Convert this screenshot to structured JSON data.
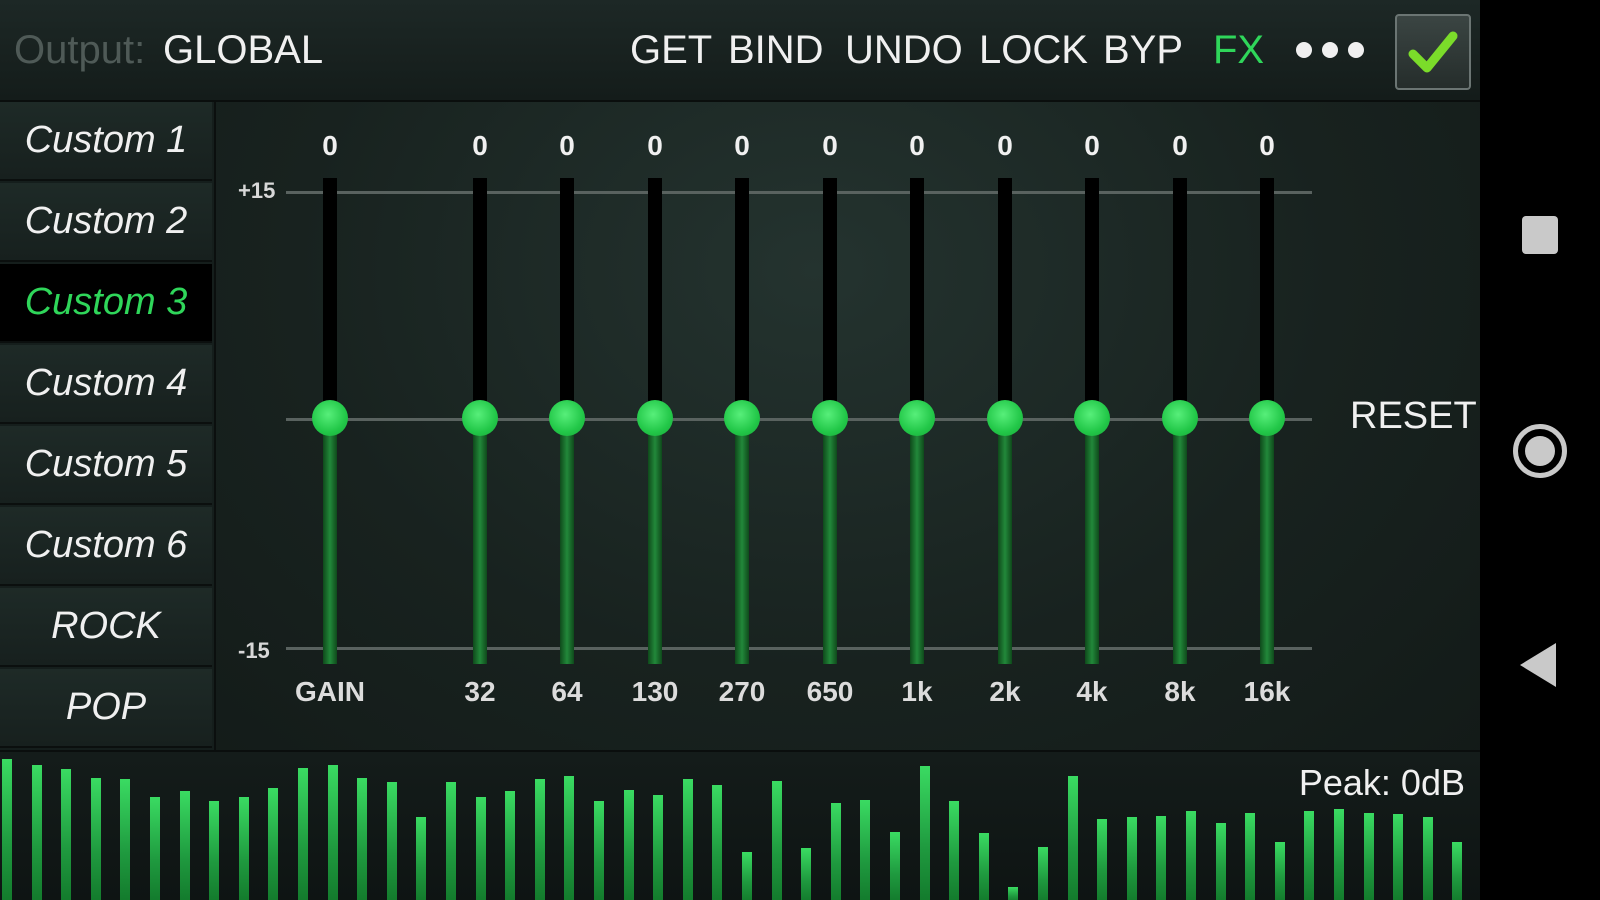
{
  "topbar": {
    "output_label": "Output:",
    "output_value": "GLOBAL",
    "buttons": [
      "GET",
      "BIND",
      "UNDO",
      "LOCK",
      "BYP",
      "FX"
    ],
    "fx_color": "#2fd65a",
    "more_icon": "more-dots-icon",
    "confirm_icon": "checkmark-icon",
    "check_color": "#7bdc2a"
  },
  "presets": {
    "items": [
      "Custom 1",
      "Custom 2",
      "Custom 3",
      "Custom 4",
      "Custom 5",
      "Custom 6",
      "ROCK",
      "POP"
    ],
    "active_index": 2,
    "active_color": "#2fd65a"
  },
  "eq": {
    "max_label": "+15",
    "min_label": "-15",
    "range_db": [
      -15,
      15
    ],
    "bands": [
      {
        "freq": "GAIN",
        "value": "0"
      },
      {
        "freq": "32",
        "value": "0"
      },
      {
        "freq": "64",
        "value": "0"
      },
      {
        "freq": "130",
        "value": "0"
      },
      {
        "freq": "270",
        "value": "0"
      },
      {
        "freq": "650",
        "value": "0"
      },
      {
        "freq": "1k",
        "value": "0"
      },
      {
        "freq": "2k",
        "value": "0"
      },
      {
        "freq": "4k",
        "value": "0"
      },
      {
        "freq": "8k",
        "value": "0"
      },
      {
        "freq": "16k",
        "value": "0"
      }
    ],
    "reset_label": "RESET",
    "knob_color": "#2fd65a"
  },
  "meter": {
    "peak_text": "Peak: 0dB",
    "levels": [
      0.98,
      0.94,
      0.91,
      0.85,
      0.84,
      0.72,
      0.76,
      0.69,
      0.72,
      0.78,
      0.92,
      0.94,
      0.85,
      0.82,
      0.58,
      0.82,
      0.72,
      0.76,
      0.84,
      0.86,
      0.69,
      0.77,
      0.73,
      0.84,
      0.8,
      0.34,
      0.83,
      0.37,
      0.68,
      0.7,
      0.48,
      0.93,
      0.69,
      0.47,
      0.1,
      0.38,
      0.86,
      0.57,
      0.58,
      0.59,
      0.62,
      0.54,
      0.61,
      0.41,
      0.62,
      0.64,
      0.61,
      0.6,
      0.58,
      0.41
    ],
    "bar_color": "#2fbf52"
  },
  "navbar": {
    "recents_icon": "recents-square-icon",
    "home_icon": "home-circle-icon",
    "back_icon": "back-triangle-icon"
  }
}
